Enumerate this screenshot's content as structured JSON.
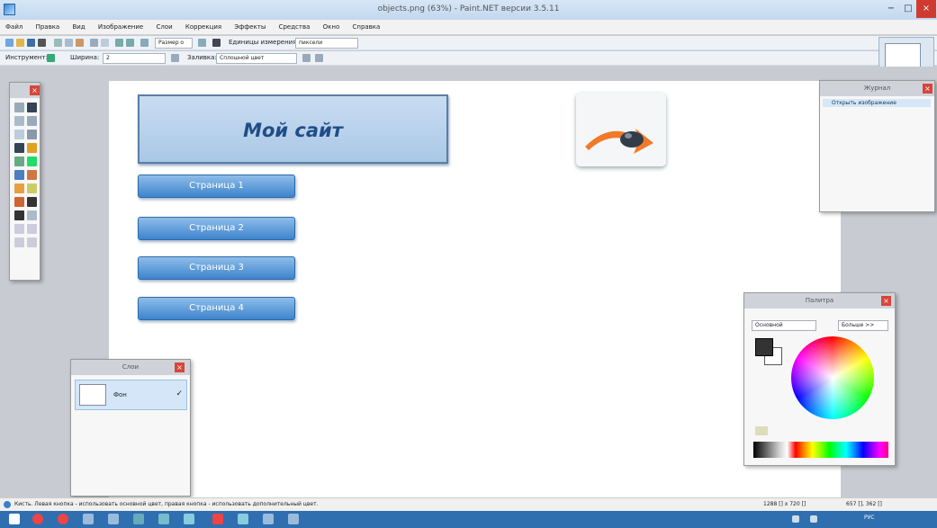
{
  "window": {
    "title": "objects.png (63%) - Paint.NET версии 3.5.11",
    "minimize_glyph": "−",
    "maximize_glyph": "□",
    "close_glyph": "×"
  },
  "menu": {
    "items": [
      "Файл",
      "Правка",
      "Вид",
      "Изображение",
      "Слои",
      "Коррекция",
      "Эффекты",
      "Средства",
      "Окно",
      "Справка"
    ]
  },
  "toolbar": {
    "size_button": "Размер о",
    "units_label": "Единицы измерения:",
    "units_value": "пиксели",
    "tool_label": "Инструмент:",
    "width_label": "Ширина:",
    "width_value": "2",
    "fill_label": "Заливка:",
    "fill_value": "Сплошной цвет"
  },
  "canvas": {
    "header_text": "Мой сайт",
    "buttons": [
      "Страница 1",
      "Страница 2",
      "Страница 3",
      "Страница 4"
    ]
  },
  "history_panel": {
    "title": "Журнал",
    "item": "Открыть изображение"
  },
  "layers_panel": {
    "title": "Слои",
    "layer_name": "Фон"
  },
  "palette_panel": {
    "title": "Палитра",
    "primary_select": "Основной",
    "more_button": "Больше >>"
  },
  "status": {
    "hint": "Кисть. Левая кнопка - использовать основной цвет, правая кнопка - использовать дополнительный цвет.",
    "image_size": "1288 [] x 720 []",
    "cursor_pos": "657 [], 362 []"
  },
  "taskbar": {
    "lang": "РУС"
  },
  "colors": {
    "accent": "#3d84cc",
    "header_text": "#1f4e86",
    "close_red": "#cf3b2f"
  }
}
